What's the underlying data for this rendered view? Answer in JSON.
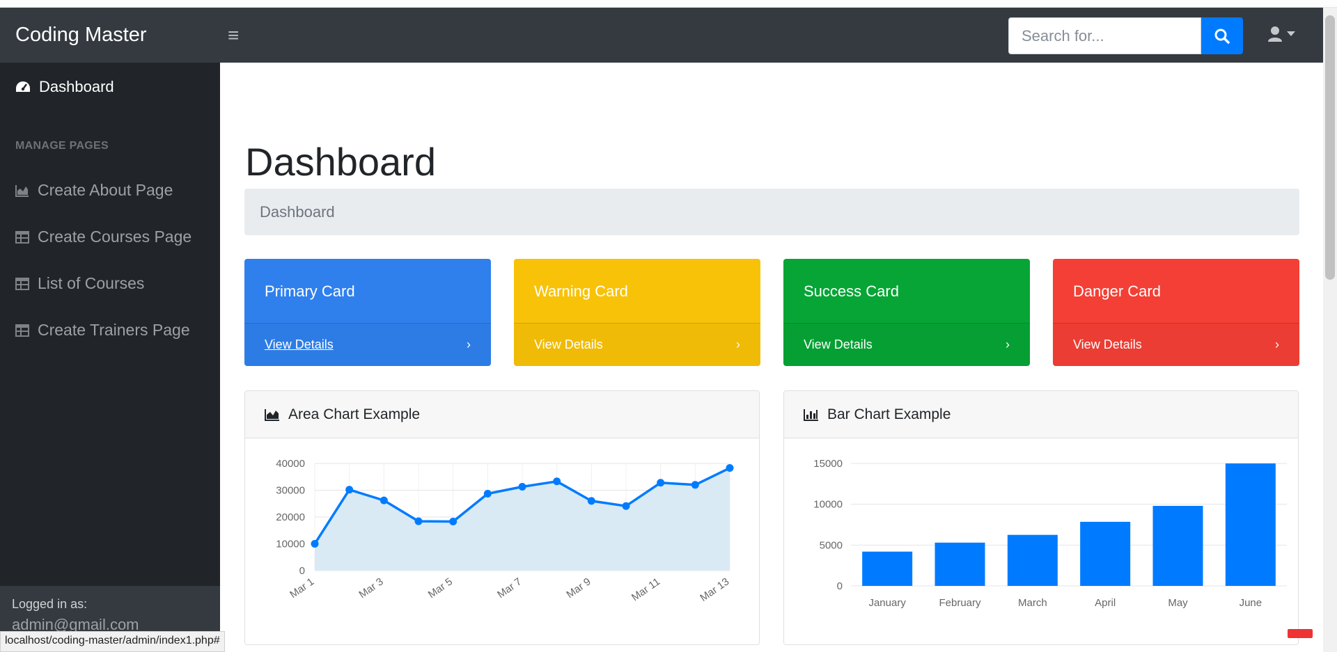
{
  "app": {
    "brand": "Coding Master"
  },
  "search": {
    "placeholder": "Search for..."
  },
  "sidebar": {
    "dashboard": "Dashboard",
    "heading": "MANAGE PAGES",
    "items": [
      {
        "label": "Create About Page",
        "icon": "area-chart-icon"
      },
      {
        "label": "Create Courses Page",
        "icon": "table-icon"
      },
      {
        "label": "List of Courses",
        "icon": "table-icon"
      },
      {
        "label": "Create Trainers Page",
        "icon": "table-icon"
      }
    ],
    "footer_label": "Logged in as:",
    "footer_email": "admin@gmail.com"
  },
  "main": {
    "title": "Dashboard",
    "breadcrumb": "Dashboard",
    "cards": [
      {
        "title": "Primary Card",
        "link": "View Details",
        "color": "#2f80ed"
      },
      {
        "title": "Warning Card",
        "link": "View Details",
        "color": "#f8c208"
      },
      {
        "title": "Success Card",
        "link": "View Details",
        "color": "#06a535"
      },
      {
        "title": "Danger Card",
        "link": "View Details",
        "color": "#f33f35"
      }
    ],
    "area_chart_title": "Area Chart Example",
    "bar_chart_title": "Bar Chart Example"
  },
  "statusbar": {
    "url": "localhost/coding-master/admin/index1.php#"
  },
  "chart_data": [
    {
      "type": "area",
      "title": "Area Chart Example",
      "x": [
        "Mar 1",
        "Mar 2",
        "Mar 3",
        "Mar 4",
        "Mar 5",
        "Mar 6",
        "Mar 7",
        "Mar 8",
        "Mar 9",
        "Mar 10",
        "Mar 11",
        "Mar 12",
        "Mar 13"
      ],
      "x_tick_labels": [
        "Mar 1",
        "Mar 3",
        "Mar 5",
        "Mar 7",
        "Mar 9",
        "Mar 11",
        "Mar 13"
      ],
      "values": [
        10000,
        30200,
        26200,
        18400,
        18300,
        28700,
        31300,
        33300,
        26000,
        24100,
        32800,
        32000,
        38300
      ],
      "ylim": [
        0,
        40000
      ],
      "y_ticks": [
        0,
        10000,
        20000,
        30000,
        40000
      ],
      "grid": true,
      "line_color": "#007bff",
      "fill_color": "#d9eaf5"
    },
    {
      "type": "bar",
      "title": "Bar Chart Example",
      "categories": [
        "January",
        "February",
        "March",
        "April",
        "May",
        "June"
      ],
      "values": [
        4200,
        5300,
        6250,
        7850,
        9800,
        15000
      ],
      "ylim": [
        0,
        15000
      ],
      "y_ticks": [
        0,
        5000,
        10000,
        15000
      ],
      "grid": true,
      "bar_color": "#007bff"
    }
  ]
}
